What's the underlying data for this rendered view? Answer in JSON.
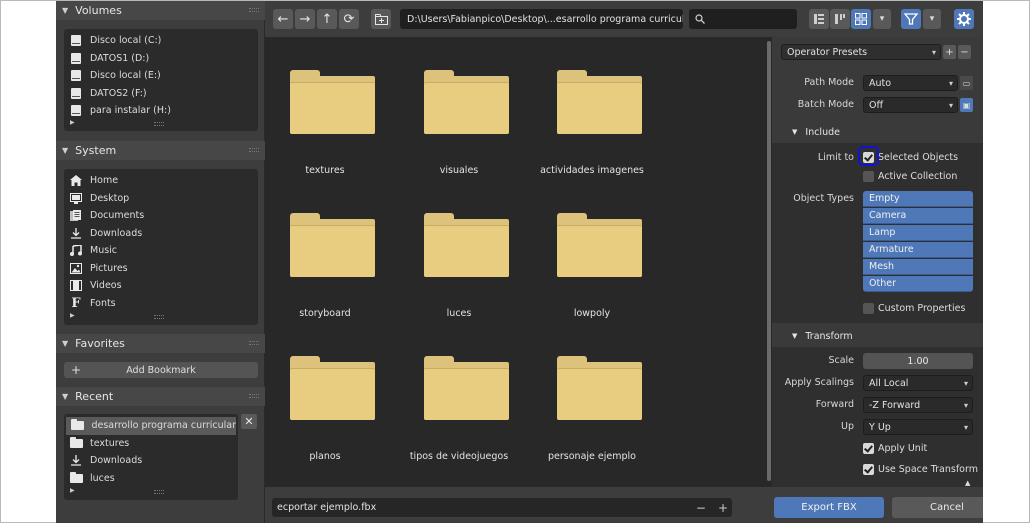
{
  "sidebar": {
    "volumes": {
      "title": "Volumes",
      "items": [
        {
          "label": "Disco local (C:)",
          "icon": "drive-icon"
        },
        {
          "label": "DATOS1 (D:)",
          "icon": "drive-icon"
        },
        {
          "label": "Disco local (E:)",
          "icon": "drive-icon"
        },
        {
          "label": "DATOS2 (F:)",
          "icon": "drive-icon"
        },
        {
          "label": "para instalar (H:)",
          "icon": "drive-icon"
        }
      ]
    },
    "system": {
      "title": "System",
      "items": [
        {
          "label": "Home",
          "icon": "home-icon"
        },
        {
          "label": "Desktop",
          "icon": "desktop-icon"
        },
        {
          "label": "Documents",
          "icon": "documents-icon"
        },
        {
          "label": "Downloads",
          "icon": "download-icon"
        },
        {
          "label": "Music",
          "icon": "music-icon"
        },
        {
          "label": "Pictures",
          "icon": "pictures-icon"
        },
        {
          "label": "Videos",
          "icon": "videos-icon"
        },
        {
          "label": "Fonts",
          "icon": "fonts-icon"
        }
      ]
    },
    "favorites": {
      "title": "Favorites",
      "add_bookmark": "Add Bookmark"
    },
    "recent": {
      "title": "Recent",
      "items": [
        {
          "label": "desarrollo programa curricular",
          "icon": "folder-icon",
          "active": true
        },
        {
          "label": "textures",
          "icon": "folder-icon"
        },
        {
          "label": "Downloads",
          "icon": "download-icon"
        },
        {
          "label": "luces",
          "icon": "folder-icon"
        }
      ]
    }
  },
  "toolbar": {
    "path": "D:\\Users\\Fabianpico\\Desktop\\...esarrollo programa curricular\\",
    "search_value": ""
  },
  "files": [
    "textures",
    "visuales",
    "actividades imagenes",
    "storyboard",
    "luces",
    "lowpoly",
    "planos",
    "tipos de videojuegos",
    "personaje ejemplo"
  ],
  "bottom": {
    "filename": "ecportar ejemplo.fbx",
    "export_label": "Export FBX",
    "cancel_label": "Cancel"
  },
  "options": {
    "operator_presets": "Operator Presets",
    "path_mode_label": "Path Mode",
    "path_mode_value": "Auto",
    "batch_mode_label": "Batch Mode",
    "batch_mode_value": "Off",
    "include": {
      "title": "Include",
      "limit_to_label": "Limit to",
      "selected_objects": "Selected Objects",
      "selected_objects_checked": true,
      "active_collection": "Active Collection",
      "active_collection_checked": false,
      "object_types_label": "Object Types",
      "object_types": [
        "Empty",
        "Camera",
        "Lamp",
        "Armature",
        "Mesh",
        "Other"
      ],
      "custom_properties": "Custom Properties",
      "custom_properties_checked": false
    },
    "transform": {
      "title": "Transform",
      "scale_label": "Scale",
      "scale_value": "1.00",
      "apply_scalings_label": "Apply Scalings",
      "apply_scalings_value": "All Local",
      "forward_label": "Forward",
      "forward_value": "-Z Forward",
      "up_label": "Up",
      "up_value": "Y Up",
      "apply_unit": "Apply Unit",
      "apply_unit_checked": true,
      "use_space_transform": "Use Space Transform",
      "use_space_transform_checked": true
    }
  },
  "colors": {
    "accent": "#4f78b8",
    "folder": "#e8cd80",
    "highlight_ring": "#1313d6"
  }
}
